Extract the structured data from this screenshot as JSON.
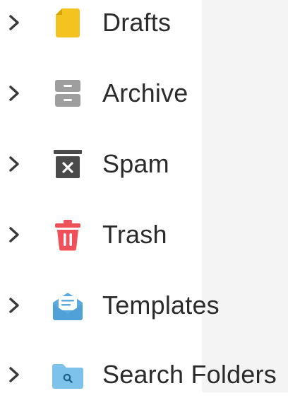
{
  "folders": [
    {
      "label": "Drafts",
      "icon": "draft-icon",
      "color": "#f5c31f"
    },
    {
      "label": "Archive",
      "icon": "archive-icon",
      "color": "#9e9e9e"
    },
    {
      "label": "Spam",
      "icon": "spam-icon",
      "color": "#4a4a4a"
    },
    {
      "label": "Trash",
      "icon": "trash-icon",
      "color": "#f0505a"
    },
    {
      "label": "Templates",
      "icon": "template-icon",
      "color": "#5aacde"
    },
    {
      "label": "Search Folders",
      "icon": "search-folder-icon",
      "color": "#7cc2ea"
    }
  ],
  "chevron_color": "#3a3a3a",
  "text_color": "#2b2b2b"
}
